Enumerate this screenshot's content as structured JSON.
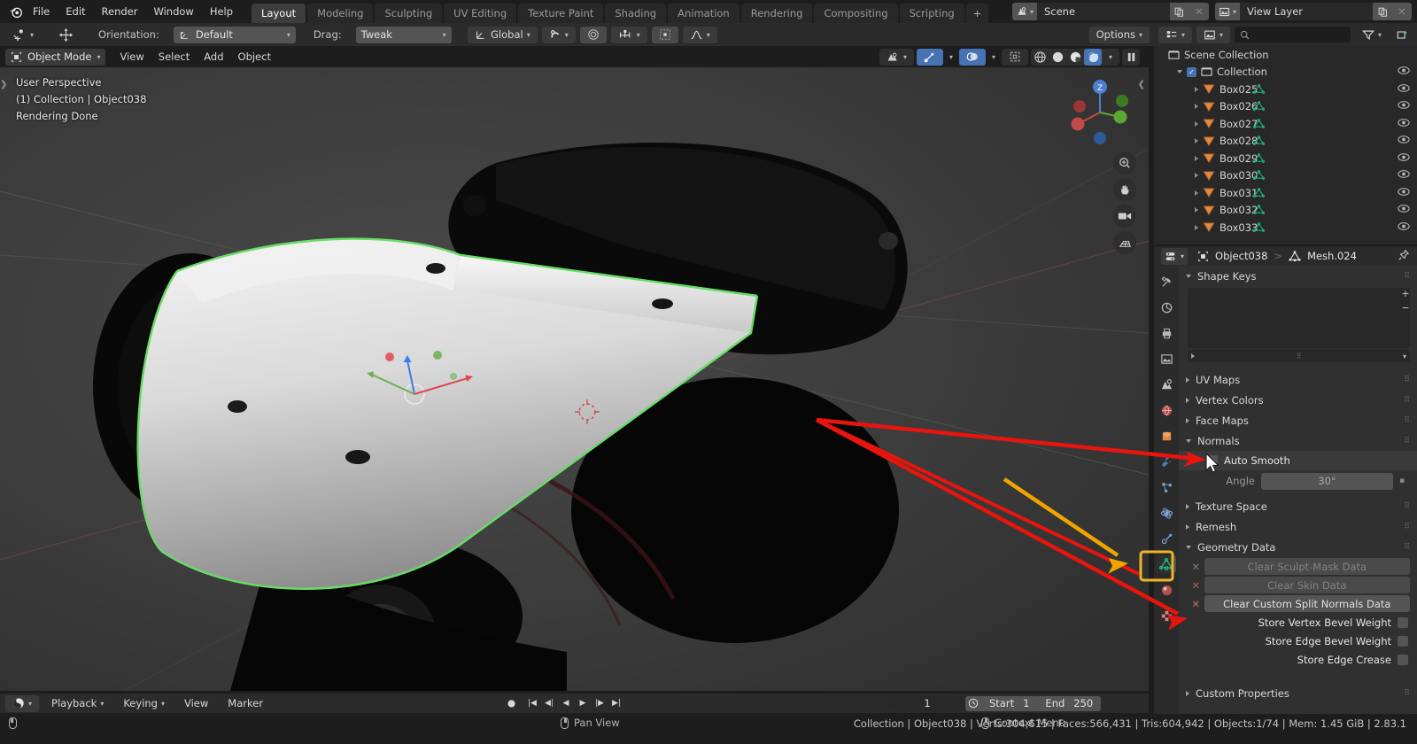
{
  "app": {
    "name": "Blender",
    "version": "2.83.1"
  },
  "menu": {
    "items": [
      "File",
      "Edit",
      "Render",
      "Window",
      "Help"
    ]
  },
  "workspace_tabs": {
    "items": [
      "Layout",
      "Modeling",
      "Sculpting",
      "UV Editing",
      "Texture Paint",
      "Shading",
      "Animation",
      "Rendering",
      "Compositing",
      "Scripting"
    ],
    "active": "Layout",
    "add_label": "+"
  },
  "scene_block": {
    "scene_icon": "scene-icon",
    "scene_name": "Scene",
    "new_scene_icon": "duplicate-icon",
    "remove_scene_icon": "close-icon",
    "viewlayer_icon": "view-layer-icon",
    "viewlayer_name": "View Layer",
    "new_layer_icon": "duplicate-icon",
    "remove_layer_icon": "close-icon"
  },
  "tool_settings": {
    "active_tool_icon": "cursor-tool-icon",
    "transform_tool_icon": "move-tool-icon",
    "orientation_label": "Orientation:",
    "orientation_value": "Default",
    "drag_label": "Drag:",
    "drag_value": "Tweak",
    "transform_orientation": "Global",
    "snap_icon": "magnet-icon",
    "proportional_icon": "proportional-edit-icon",
    "proportional_falloff_icon": "falloff-curve-icon",
    "options_label": "Options"
  },
  "view_header": {
    "mode": "Object Mode",
    "menus": [
      "View",
      "Select",
      "Add",
      "Object"
    ],
    "right_icons": [
      "visibility-icon",
      "gizmo-icon",
      "overlays-icon",
      "xray-icon",
      "shading-wireframe-icon",
      "shading-solid-icon",
      "shading-material-icon",
      "shading-rendered-icon"
    ]
  },
  "viewport": {
    "perspective": "User Perspective",
    "collection_object": "(1) Collection | Object038",
    "status": "Rendering Done",
    "gizmo_axes": [
      "X",
      "Y",
      "Z"
    ],
    "nav_buttons": [
      "zoom-icon",
      "hand-pan-icon",
      "camera-icon",
      "grid-ortho-icon"
    ]
  },
  "timeline": {
    "editor_icon": "timeline-editor-icon",
    "menus": [
      "Playback",
      "Keying",
      "View",
      "Marker"
    ],
    "current_frame": "1",
    "start_label": "Start",
    "start_value": "1",
    "end_label": "End",
    "end_value": "250",
    "transport": [
      "jump-start-icon",
      "prev-keyframe-icon",
      "play-reverse-icon",
      "play-icon",
      "next-keyframe-icon",
      "jump-end-icon"
    ],
    "record_icon": "record-icon"
  },
  "outliner": {
    "display_mode_icon": "outliner-display-icon",
    "filter_id_icon": "view-layer-icon",
    "search_placeholder": "",
    "search_icon": "search-icon",
    "filter_icon": "filter-icon",
    "new_collection_icon": "new-collection-icon",
    "rows": [
      {
        "label": "Scene Collection",
        "indent": 0,
        "icon": "collection-icon",
        "has_checkbox": false,
        "has_disclosure": false,
        "has_eye": false,
        "has_mesh_data": false
      },
      {
        "label": "Collection",
        "indent": 1,
        "icon": "collection-icon",
        "has_checkbox": true,
        "has_disclosure": true,
        "has_eye": true,
        "has_mesh_data": false
      },
      {
        "label": "Box025",
        "indent": 2,
        "icon": "object-mesh-icon",
        "has_checkbox": false,
        "has_disclosure": true,
        "has_eye": true,
        "has_mesh_data": true
      },
      {
        "label": "Box026",
        "indent": 2,
        "icon": "object-mesh-icon",
        "has_checkbox": false,
        "has_disclosure": true,
        "has_eye": true,
        "has_mesh_data": true
      },
      {
        "label": "Box027",
        "indent": 2,
        "icon": "object-mesh-icon",
        "has_checkbox": false,
        "has_disclosure": true,
        "has_eye": true,
        "has_mesh_data": true
      },
      {
        "label": "Box028",
        "indent": 2,
        "icon": "object-mesh-icon",
        "has_checkbox": false,
        "has_disclosure": true,
        "has_eye": true,
        "has_mesh_data": true
      },
      {
        "label": "Box029",
        "indent": 2,
        "icon": "object-mesh-icon",
        "has_checkbox": false,
        "has_disclosure": true,
        "has_eye": true,
        "has_mesh_data": true
      },
      {
        "label": "Box030",
        "indent": 2,
        "icon": "object-mesh-icon",
        "has_checkbox": false,
        "has_disclosure": true,
        "has_eye": true,
        "has_mesh_data": true
      },
      {
        "label": "Box031",
        "indent": 2,
        "icon": "object-mesh-icon",
        "has_checkbox": false,
        "has_disclosure": true,
        "has_eye": true,
        "has_mesh_data": true
      },
      {
        "label": "Box032",
        "indent": 2,
        "icon": "object-mesh-icon",
        "has_checkbox": false,
        "has_disclosure": true,
        "has_eye": true,
        "has_mesh_data": true
      },
      {
        "label": "Box033",
        "indent": 2,
        "icon": "object-mesh-icon",
        "has_checkbox": false,
        "has_disclosure": true,
        "has_eye": true,
        "has_mesh_data": true
      }
    ]
  },
  "properties": {
    "editor_icon": "properties-editor-icon",
    "breadcrumb_object_icon": "object-icon",
    "breadcrumb_object": "Object038",
    "breadcrumb_sep": ">",
    "breadcrumb_data_icon": "mesh-data-icon",
    "breadcrumb_data": "Mesh.024",
    "pin_icon": "pin-icon",
    "tabs": [
      {
        "name": "tool-tab",
        "icon": "tool-icon",
        "active": false
      },
      {
        "name": "render-tab",
        "icon": "render-icon",
        "active": false
      },
      {
        "name": "output-tab",
        "icon": "printer-icon",
        "active": false
      },
      {
        "name": "view-layer-tab",
        "icon": "images-icon",
        "active": false
      },
      {
        "name": "scene-tab",
        "icon": "scene-icon",
        "active": false
      },
      {
        "name": "world-tab",
        "icon": "world-icon",
        "active": false
      },
      {
        "name": "object-tab",
        "icon": "object-orange-icon",
        "active": false
      },
      {
        "name": "modifier-tab",
        "icon": "wrench-icon",
        "active": false
      },
      {
        "name": "particles-tab",
        "icon": "particles-icon",
        "active": false
      },
      {
        "name": "physics-tab",
        "icon": "physics-icon",
        "active": false
      },
      {
        "name": "constraints-tab",
        "icon": "constraint-icon",
        "active": false
      },
      {
        "name": "data-tab",
        "icon": "mesh-data-icon",
        "active": true
      },
      {
        "name": "material-tab",
        "icon": "material-icon",
        "active": false
      },
      {
        "name": "texture-tab",
        "icon": "texture-checker-icon",
        "active": false
      }
    ],
    "panels": [
      {
        "title": "Shape Keys",
        "open": true
      },
      {
        "title": "UV Maps",
        "open": false
      },
      {
        "title": "Vertex Colors",
        "open": false
      },
      {
        "title": "Face Maps",
        "open": false
      },
      {
        "title": "Normals",
        "open": true
      },
      {
        "title": "Texture Space",
        "open": false
      },
      {
        "title": "Remesh",
        "open": false
      },
      {
        "title": "Geometry Data",
        "open": true
      },
      {
        "title": "Custom Properties",
        "open": false
      }
    ],
    "normals": {
      "auto_smooth_label": "Auto Smooth",
      "auto_smooth_checked": false,
      "angle_label": "Angle",
      "angle_value": "30°"
    },
    "geometry_data": {
      "clear_sculpt_mask": "Clear Sculpt-Mask Data",
      "clear_skin": "Clear Skin Data",
      "clear_custom_split_normals": "Clear Custom Split Normals Data",
      "store_vertex_bevel_weight": "Store Vertex Bevel Weight",
      "store_edge_bevel_weight": "Store Edge Bevel Weight",
      "store_edge_crease": "Store Edge Crease"
    }
  },
  "status_bar": {
    "hints": [
      {
        "icon": "mouse-left-icon",
        "label": ""
      },
      {
        "icon": "mouse-middle-icon",
        "label": "Pan View"
      },
      {
        "icon": "mouse-right-icon",
        "label": "Context Menu"
      }
    ],
    "info": "Collection | Object038 | Verts:304,615 | Faces:566,431 | Tris:604,942 | Objects:1/74 | Mem: 1.45 GiB | 2.83.1"
  },
  "annotations": {
    "arrow_color_red": "#e8140e",
    "arrow_color_orange": "#f0a400",
    "highlight_box_color": "#f0b429"
  },
  "colors": {
    "accent_blue": "#4772b3",
    "bg_dark": "#1d1d1d",
    "bg_mid": "#2b2b2b",
    "bg_panel": "#303030",
    "viewport_bg": "#393939",
    "selected_outline": "#6fdd6f",
    "mesh_data_green": "#1eb086",
    "object_orange": "#e08a46"
  }
}
